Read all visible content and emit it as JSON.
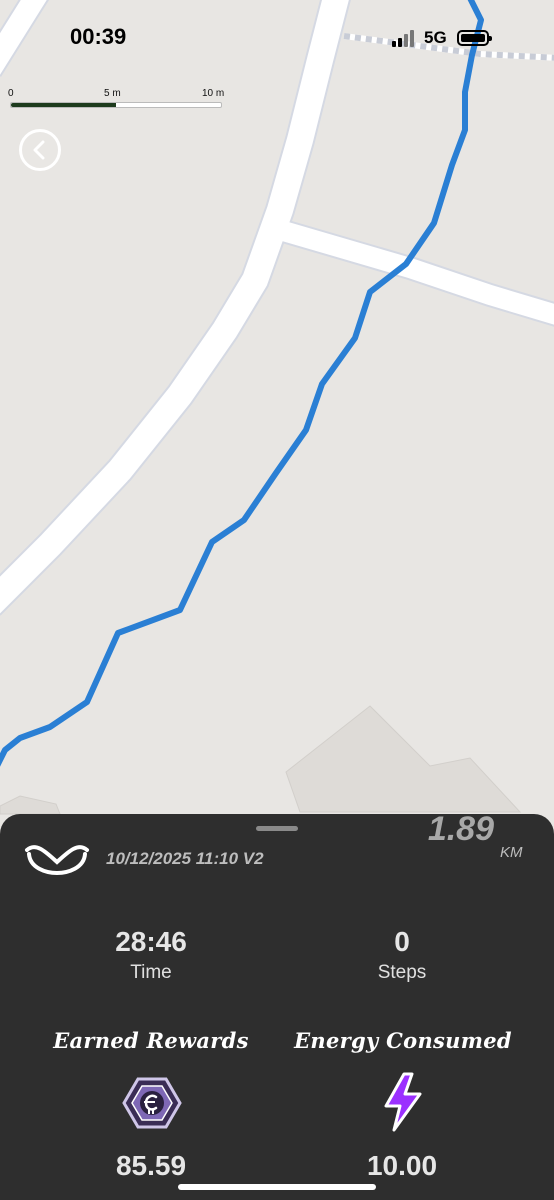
{
  "status_bar": {
    "time": "00:39",
    "network": "5G"
  },
  "map": {
    "scale_labels": [
      "0",
      "5 m",
      "10 m"
    ],
    "route_color": "#2a7fd4"
  },
  "panel": {
    "session_datetime": "10/12/2025 11:10 V2",
    "distance_value": "1.89",
    "distance_unit": "KM",
    "time_value": "28:46",
    "time_label": "Time",
    "steps_value": "0",
    "steps_label": "Steps",
    "rewards_label": "Earned Rewards",
    "rewards_value": "85.59",
    "energy_label": "Energy Consumed",
    "energy_value": "10.00"
  },
  "icons": {
    "back": "chevron-left-icon",
    "logo": "app-logo-icon",
    "reward": "reward-token-icon",
    "energy": "lightning-bolt-icon"
  },
  "colors": {
    "panel_bg": "#2e2e2e",
    "map_bg": "#e8e6e3",
    "energy_purple": "#9b30ff"
  }
}
